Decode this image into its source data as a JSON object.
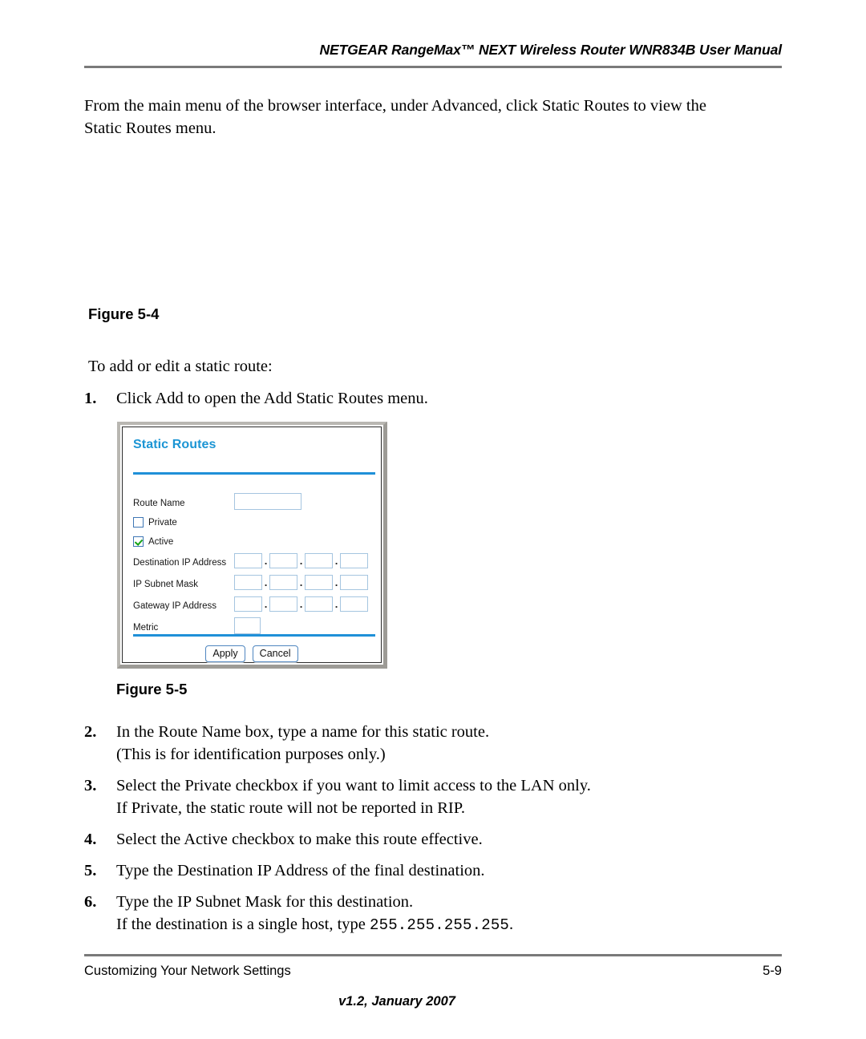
{
  "header": {
    "title": "NETGEAR RangeMax™ NEXT Wireless Router WNR834B User Manual"
  },
  "intro": {
    "line1": "From the main menu of the browser interface, under Advanced, click Static Routes to view the",
    "line2": "Static Routes menu."
  },
  "figures": {
    "fig_5_4": "Figure 5-4",
    "fig_5_5": "Figure 5-5"
  },
  "lead_in": "To add or edit a static route:",
  "steps_top": [
    {
      "num": "1.",
      "lines": [
        "Click Add to open the Add Static Routes menu."
      ]
    }
  ],
  "steps_bottom": [
    {
      "num": "2.",
      "lines": [
        "In the Route Name box, type a name for this static route.",
        "(This is for identification purposes only.)"
      ]
    },
    {
      "num": "3.",
      "lines": [
        "Select the Private checkbox if you want to limit access to the LAN only.",
        "If Private, the static route will not be reported in RIP."
      ]
    },
    {
      "num": "4.",
      "lines": [
        "Select the Active checkbox to make this route effective."
      ]
    },
    {
      "num": "5.",
      "lines": [
        "Type the Destination IP Address of the final destination."
      ]
    },
    {
      "num": "6.",
      "lines": [
        "Type the IP Subnet Mask for this destination."
      ],
      "last_line_prefix": "If the destination is a single host, type ",
      "last_line_mono": "255.255.255.255",
      "last_line_suffix": "."
    }
  ],
  "dialog": {
    "title": "Static Routes",
    "accent_color": "#1f90d8",
    "fields": {
      "route_name_label": "Route Name",
      "route_name_value": "",
      "private_label": "Private",
      "private_checked": false,
      "active_label": "Active",
      "active_checked": true,
      "destination_ip_label": "Destination IP Address",
      "destination_ip_octets": [
        "",
        "",
        "",
        ""
      ],
      "subnet_mask_label": "IP Subnet Mask",
      "subnet_mask_octets": [
        "",
        "",
        "",
        ""
      ],
      "gateway_ip_label": "Gateway IP Address",
      "gateway_ip_octets": [
        "",
        "",
        "",
        ""
      ],
      "metric_label": "Metric",
      "metric_value": "",
      "octet_separator": "."
    },
    "buttons": {
      "apply": "Apply",
      "cancel": "Cancel"
    }
  },
  "footer": {
    "section": "Customizing Your Network Settings",
    "page_number": "5-9",
    "version": "v1.2, January 2007"
  }
}
